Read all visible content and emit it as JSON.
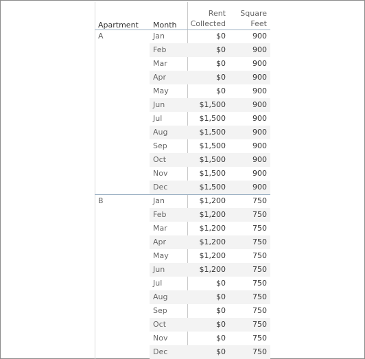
{
  "headers": {
    "apartment": "Apartment",
    "month": "Month",
    "rent_line1": "Rent",
    "rent_line2": "Collected",
    "square_line1": "Square",
    "square_line2": "Feet"
  },
  "groups": [
    {
      "apartment": "A",
      "rows": [
        {
          "month": "Jan",
          "rent": "$0",
          "sqft": "900"
        },
        {
          "month": "Feb",
          "rent": "$0",
          "sqft": "900"
        },
        {
          "month": "Mar",
          "rent": "$0",
          "sqft": "900"
        },
        {
          "month": "Apr",
          "rent": "$0",
          "sqft": "900"
        },
        {
          "month": "May",
          "rent": "$0",
          "sqft": "900"
        },
        {
          "month": "Jun",
          "rent": "$1,500",
          "sqft": "900"
        },
        {
          "month": "Jul",
          "rent": "$1,500",
          "sqft": "900"
        },
        {
          "month": "Aug",
          "rent": "$1,500",
          "sqft": "900"
        },
        {
          "month": "Sep",
          "rent": "$1,500",
          "sqft": "900"
        },
        {
          "month": "Oct",
          "rent": "$1,500",
          "sqft": "900"
        },
        {
          "month": "Nov",
          "rent": "$1,500",
          "sqft": "900"
        },
        {
          "month": "Dec",
          "rent": "$1,500",
          "sqft": "900"
        }
      ]
    },
    {
      "apartment": "B",
      "rows": [
        {
          "month": "Jan",
          "rent": "$1,200",
          "sqft": "750"
        },
        {
          "month": "Feb",
          "rent": "$1,200",
          "sqft": "750"
        },
        {
          "month": "Mar",
          "rent": "$1,200",
          "sqft": "750"
        },
        {
          "month": "Apr",
          "rent": "$1,200",
          "sqft": "750"
        },
        {
          "month": "May",
          "rent": "$1,200",
          "sqft": "750"
        },
        {
          "month": "Jun",
          "rent": "$1,200",
          "sqft": "750"
        },
        {
          "month": "Jul",
          "rent": "$0",
          "sqft": "750"
        },
        {
          "month": "Aug",
          "rent": "$0",
          "sqft": "750"
        },
        {
          "month": "Sep",
          "rent": "$0",
          "sqft": "750"
        },
        {
          "month": "Oct",
          "rent": "$0",
          "sqft": "750"
        },
        {
          "month": "Nov",
          "rent": "$0",
          "sqft": "750"
        },
        {
          "month": "Dec",
          "rent": "$0",
          "sqft": "750"
        }
      ]
    }
  ]
}
